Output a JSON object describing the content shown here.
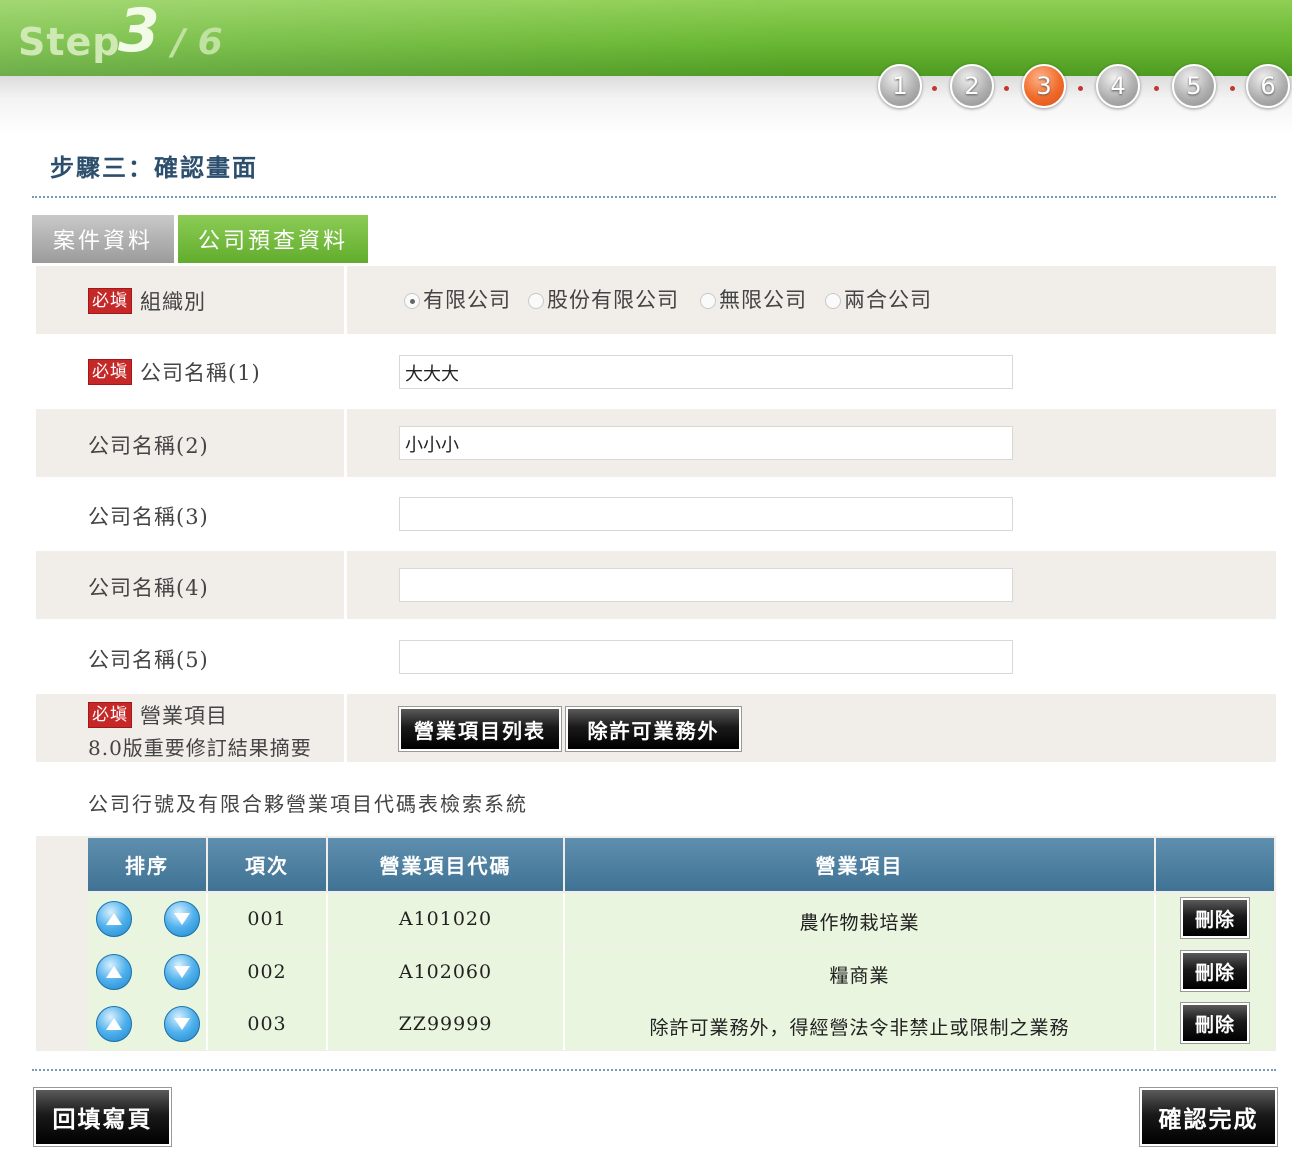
{
  "header": {
    "step_word": "Step",
    "step_current": "3",
    "step_total": "/ 6",
    "steps": [
      "1",
      "2",
      "3",
      "4",
      "5",
      "6"
    ],
    "active_step": "3"
  },
  "page_title": "步驟三：確認畫面",
  "tabs": [
    {
      "label": "案件資料",
      "active": false
    },
    {
      "label": "公司預查資料",
      "active": true
    }
  ],
  "required_badge": "必塡",
  "form": {
    "org_type": {
      "label": "組織別",
      "options": [
        "有限公司",
        "股份有限公司",
        "無限公司",
        "兩合公司"
      ],
      "selected": "有限公司"
    },
    "name1": {
      "label": "公司名稱(1)",
      "value": "大大大"
    },
    "name2": {
      "label": "公司名稱(2)",
      "value": "小小小"
    },
    "name3": {
      "label": "公司名稱(3)",
      "value": ""
    },
    "name4": {
      "label": "公司名稱(4)",
      "value": ""
    },
    "name5": {
      "label": "公司名稱(5)",
      "value": ""
    },
    "business": {
      "label": "營業項目",
      "sub_link": "8.0版重要修訂結果摘要",
      "list_button": "營業項目列表",
      "exclude_button": "除許可業務外"
    }
  },
  "system_link": "公司行號及有限合夥營業項目代碼表檢索系統",
  "table": {
    "headers": [
      "排序",
      "項次",
      "營業項目代碼",
      "營業項目",
      ""
    ],
    "rows": [
      {
        "index": "001",
        "code": "A101020",
        "item": "農作物栽培業",
        "delete": "刪除"
      },
      {
        "index": "002",
        "code": "A102060",
        "item": "糧商業",
        "delete": "刪除"
      },
      {
        "index": "003",
        "code": "ZZ99999",
        "item": "除許可業務外，得經營法令非禁止或限制之業務",
        "delete": "刪除"
      }
    ]
  },
  "footer": {
    "back_button": "回填寫頁",
    "confirm_button": "確認完成"
  },
  "colors": {
    "banner_green": "#6ab833",
    "active_step": "#f06a2a",
    "table_header": "#4a7d9e",
    "required_red": "#c62828"
  }
}
